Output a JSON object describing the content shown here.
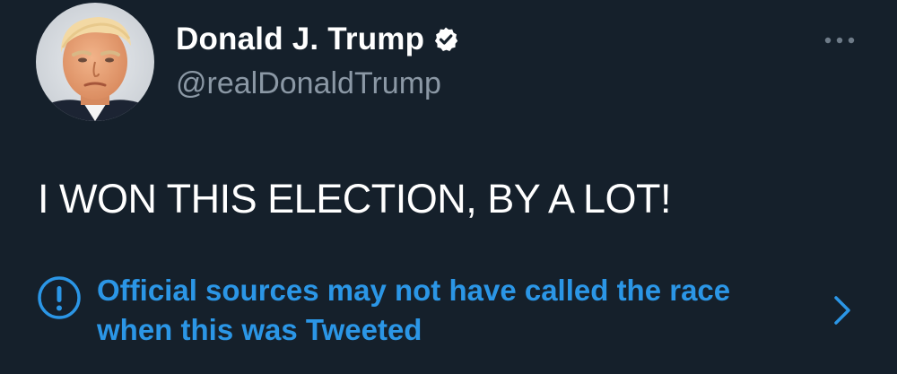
{
  "author": {
    "display_name": "Donald J. Trump",
    "handle": "@realDonaldTrump",
    "verified": true,
    "avatar_icon": "profile-photo"
  },
  "tweet": {
    "text": "I WON THIS ELECTION, BY A LOT!"
  },
  "notice": {
    "text": "Official sources may not have called the race when this was Tweeted",
    "icon": "exclamation-circle-icon"
  },
  "menu": {
    "icon": "more-options-icon"
  },
  "colors": {
    "background": "#15202b",
    "primary_text": "#ffffff",
    "secondary_text": "#8b98a5",
    "accent": "#2b96e6"
  }
}
